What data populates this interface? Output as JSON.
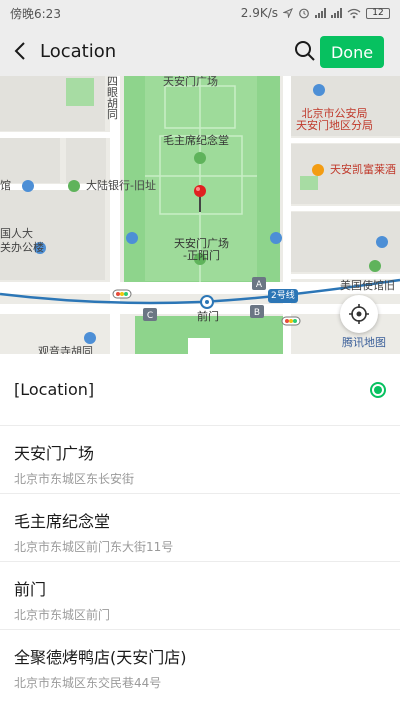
{
  "status": {
    "time": "傍晚6:23",
    "net_speed": "2.9K/s",
    "battery": "12"
  },
  "nav": {
    "title": "Location",
    "done_label": "Done"
  },
  "map": {
    "labels": {
      "siyiehutong": "四眼胡同",
      "tiananmen_sq": "天安门广场",
      "mausoleum": "毛主席纪念堂",
      "bank": "大陆银行-旧址",
      "guan": "馆",
      "renda": "国人大",
      "office": "关办公楼",
      "sq_zhengyangmen": "天安门广场\n-正阳门",
      "qianmen": "前门",
      "line2": "2号线",
      "police_bureau": "北京市公安局\n天安门地区分局",
      "hotel": "天安凯富莱酒",
      "embassy": "美国使馆旧",
      "tencent_map": "腾讯地图",
      "bottom_partial": "观音寺胡同"
    },
    "colors": {
      "park": "#8ed48c",
      "road": "#ffffff",
      "subway": "#2c76b6",
      "pin": "#e02020"
    }
  },
  "places": [
    {
      "name": "[Location]",
      "address": "",
      "selected": true
    },
    {
      "name": "天安门广场",
      "address": "北京市东城区东长安街"
    },
    {
      "name": "毛主席纪念堂",
      "address": "北京市东城区前门东大街11号"
    },
    {
      "name": "前门",
      "address": "北京市东城区前门"
    },
    {
      "name": "全聚德烤鸭店(天安门店)",
      "address": "北京市东城区东交民巷44号"
    }
  ]
}
